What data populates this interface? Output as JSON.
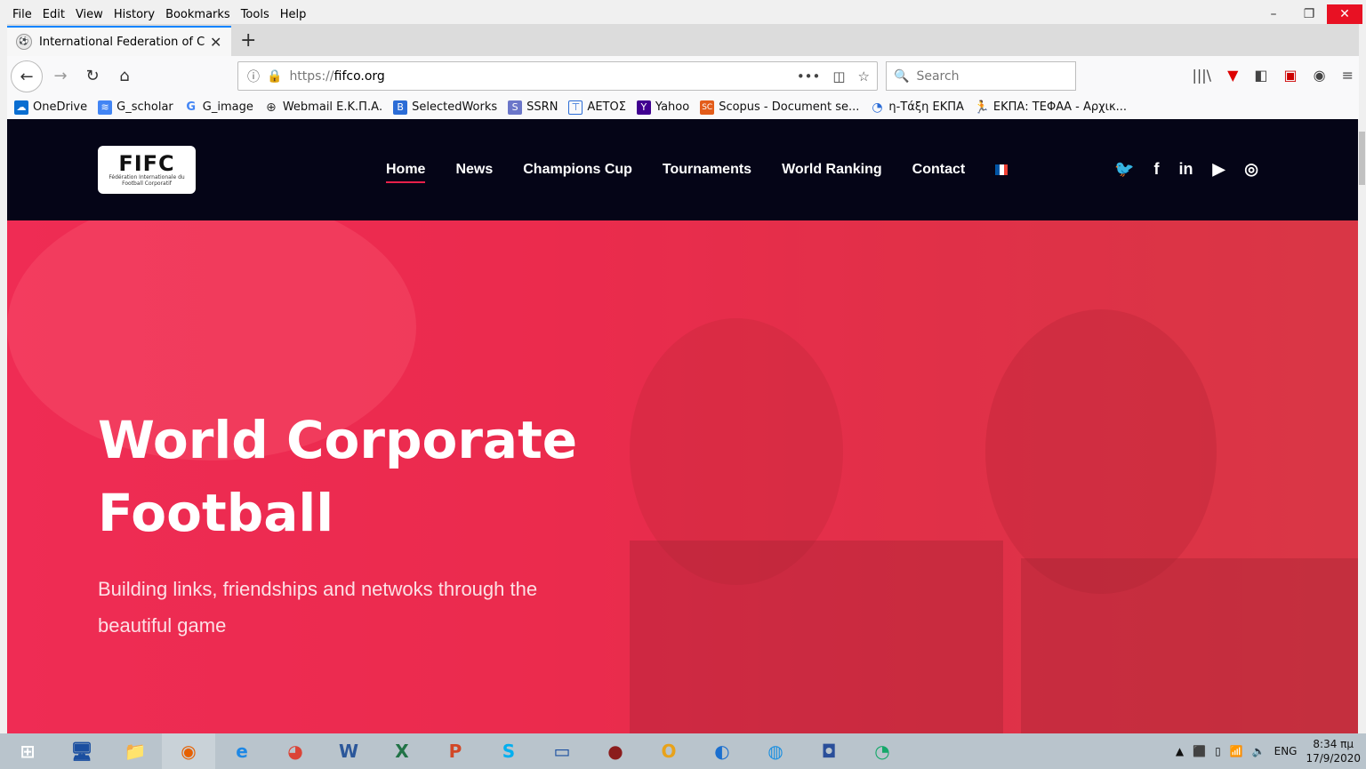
{
  "menubar": [
    "File",
    "Edit",
    "View",
    "History",
    "Bookmarks",
    "Tools",
    "Help"
  ],
  "window_controls": {
    "minimize": "–",
    "restore": "❐",
    "close": "✕"
  },
  "tab": {
    "title": "International Federation of Cor",
    "close": "✕",
    "new": "+"
  },
  "nav": {
    "url_scheme": "https://",
    "url_host": "fifco.org",
    "search_placeholder": "Search"
  },
  "bookmarks": [
    {
      "label": "OneDrive",
      "icon": "cloud-icon",
      "color": "#0a6ed1"
    },
    {
      "label": "G_scholar",
      "icon": "scholar-icon",
      "color": "#4285f4"
    },
    {
      "label": "G_image",
      "icon": "google-icon",
      "color": "#ffffff"
    },
    {
      "label": "Webmail Ε.Κ.Π.Α.",
      "icon": "globe-icon",
      "color": "#ffffff"
    },
    {
      "label": "SelectedWorks",
      "icon": "bookmark-icon",
      "color": "#2b6cd6"
    },
    {
      "label": "SSRN",
      "icon": "ssrn-icon",
      "color": "#6b76c9"
    },
    {
      "label": "ΑΕΤΟΣ",
      "icon": "page-icon",
      "color": "#ffffff"
    },
    {
      "label": "Yahoo",
      "icon": "yahoo-icon",
      "color": "#400090"
    },
    {
      "label": "Scopus - Document se...",
      "icon": "scopus-icon",
      "color": "#e35c1a"
    },
    {
      "label": "η-Τάξη ΕΚΠΑ",
      "icon": "eclass-icon",
      "color": "#ffffff"
    },
    {
      "label": "ΕΚΠΑ: ΤΕΦΑΑ - Αρχικ...",
      "icon": "runner-icon",
      "color": "#ffffff"
    }
  ],
  "site": {
    "logo_text": "FIFC",
    "logo_sub": "Fédération Internationale du Football Corporatif",
    "menu": [
      "Home",
      "News",
      "Champions Cup",
      "Tournaments",
      "World Ranking",
      "Contact"
    ],
    "social": [
      "twitter-icon",
      "facebook-icon",
      "linkedin-icon",
      "youtube-icon",
      "instagram-icon"
    ],
    "hero_title": "World Corporate Football",
    "hero_subtitle": "Building links, friendships and netwoks through the beautiful game"
  },
  "taskbar": {
    "apps": [
      "windows-start-icon",
      "remote-desktop-icon",
      "file-explorer-icon",
      "firefox-icon",
      "ie-icon",
      "chrome-icon",
      "word-icon",
      "excel-icon",
      "powerpoint-icon",
      "skype-icon",
      "app-icon",
      "media-icon",
      "outlook-icon",
      "app2-icon",
      "app3-icon",
      "app4-icon",
      "app5-icon"
    ],
    "lang": "ENG",
    "time": "8:34 πμ",
    "date": "17/9/2020"
  }
}
